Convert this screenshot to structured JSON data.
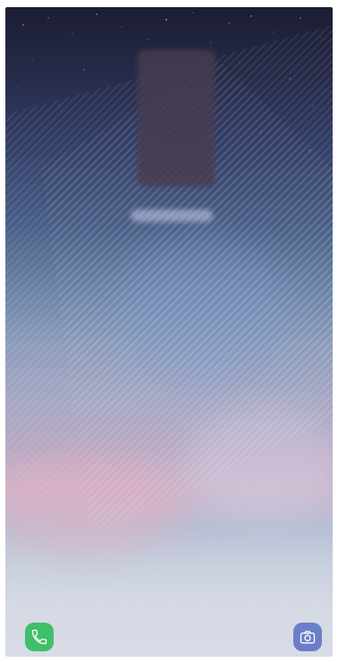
{
  "screen": {
    "type": "lock-screen",
    "wallpaper": "starry-night-gradient",
    "clock": {
      "state": "blurred"
    },
    "date": {
      "state": "blurred"
    }
  },
  "shortcuts": {
    "left": {
      "icon": "phone-icon",
      "color": "#3fbf6a"
    },
    "right": {
      "icon": "camera-icon",
      "color": "#6b7fc9"
    }
  },
  "colors": {
    "sky_top": "#1b1d33",
    "sky_mid": "#4a6088",
    "pink_haze": "#c9b4c9",
    "horizon": "#d8dce6"
  }
}
